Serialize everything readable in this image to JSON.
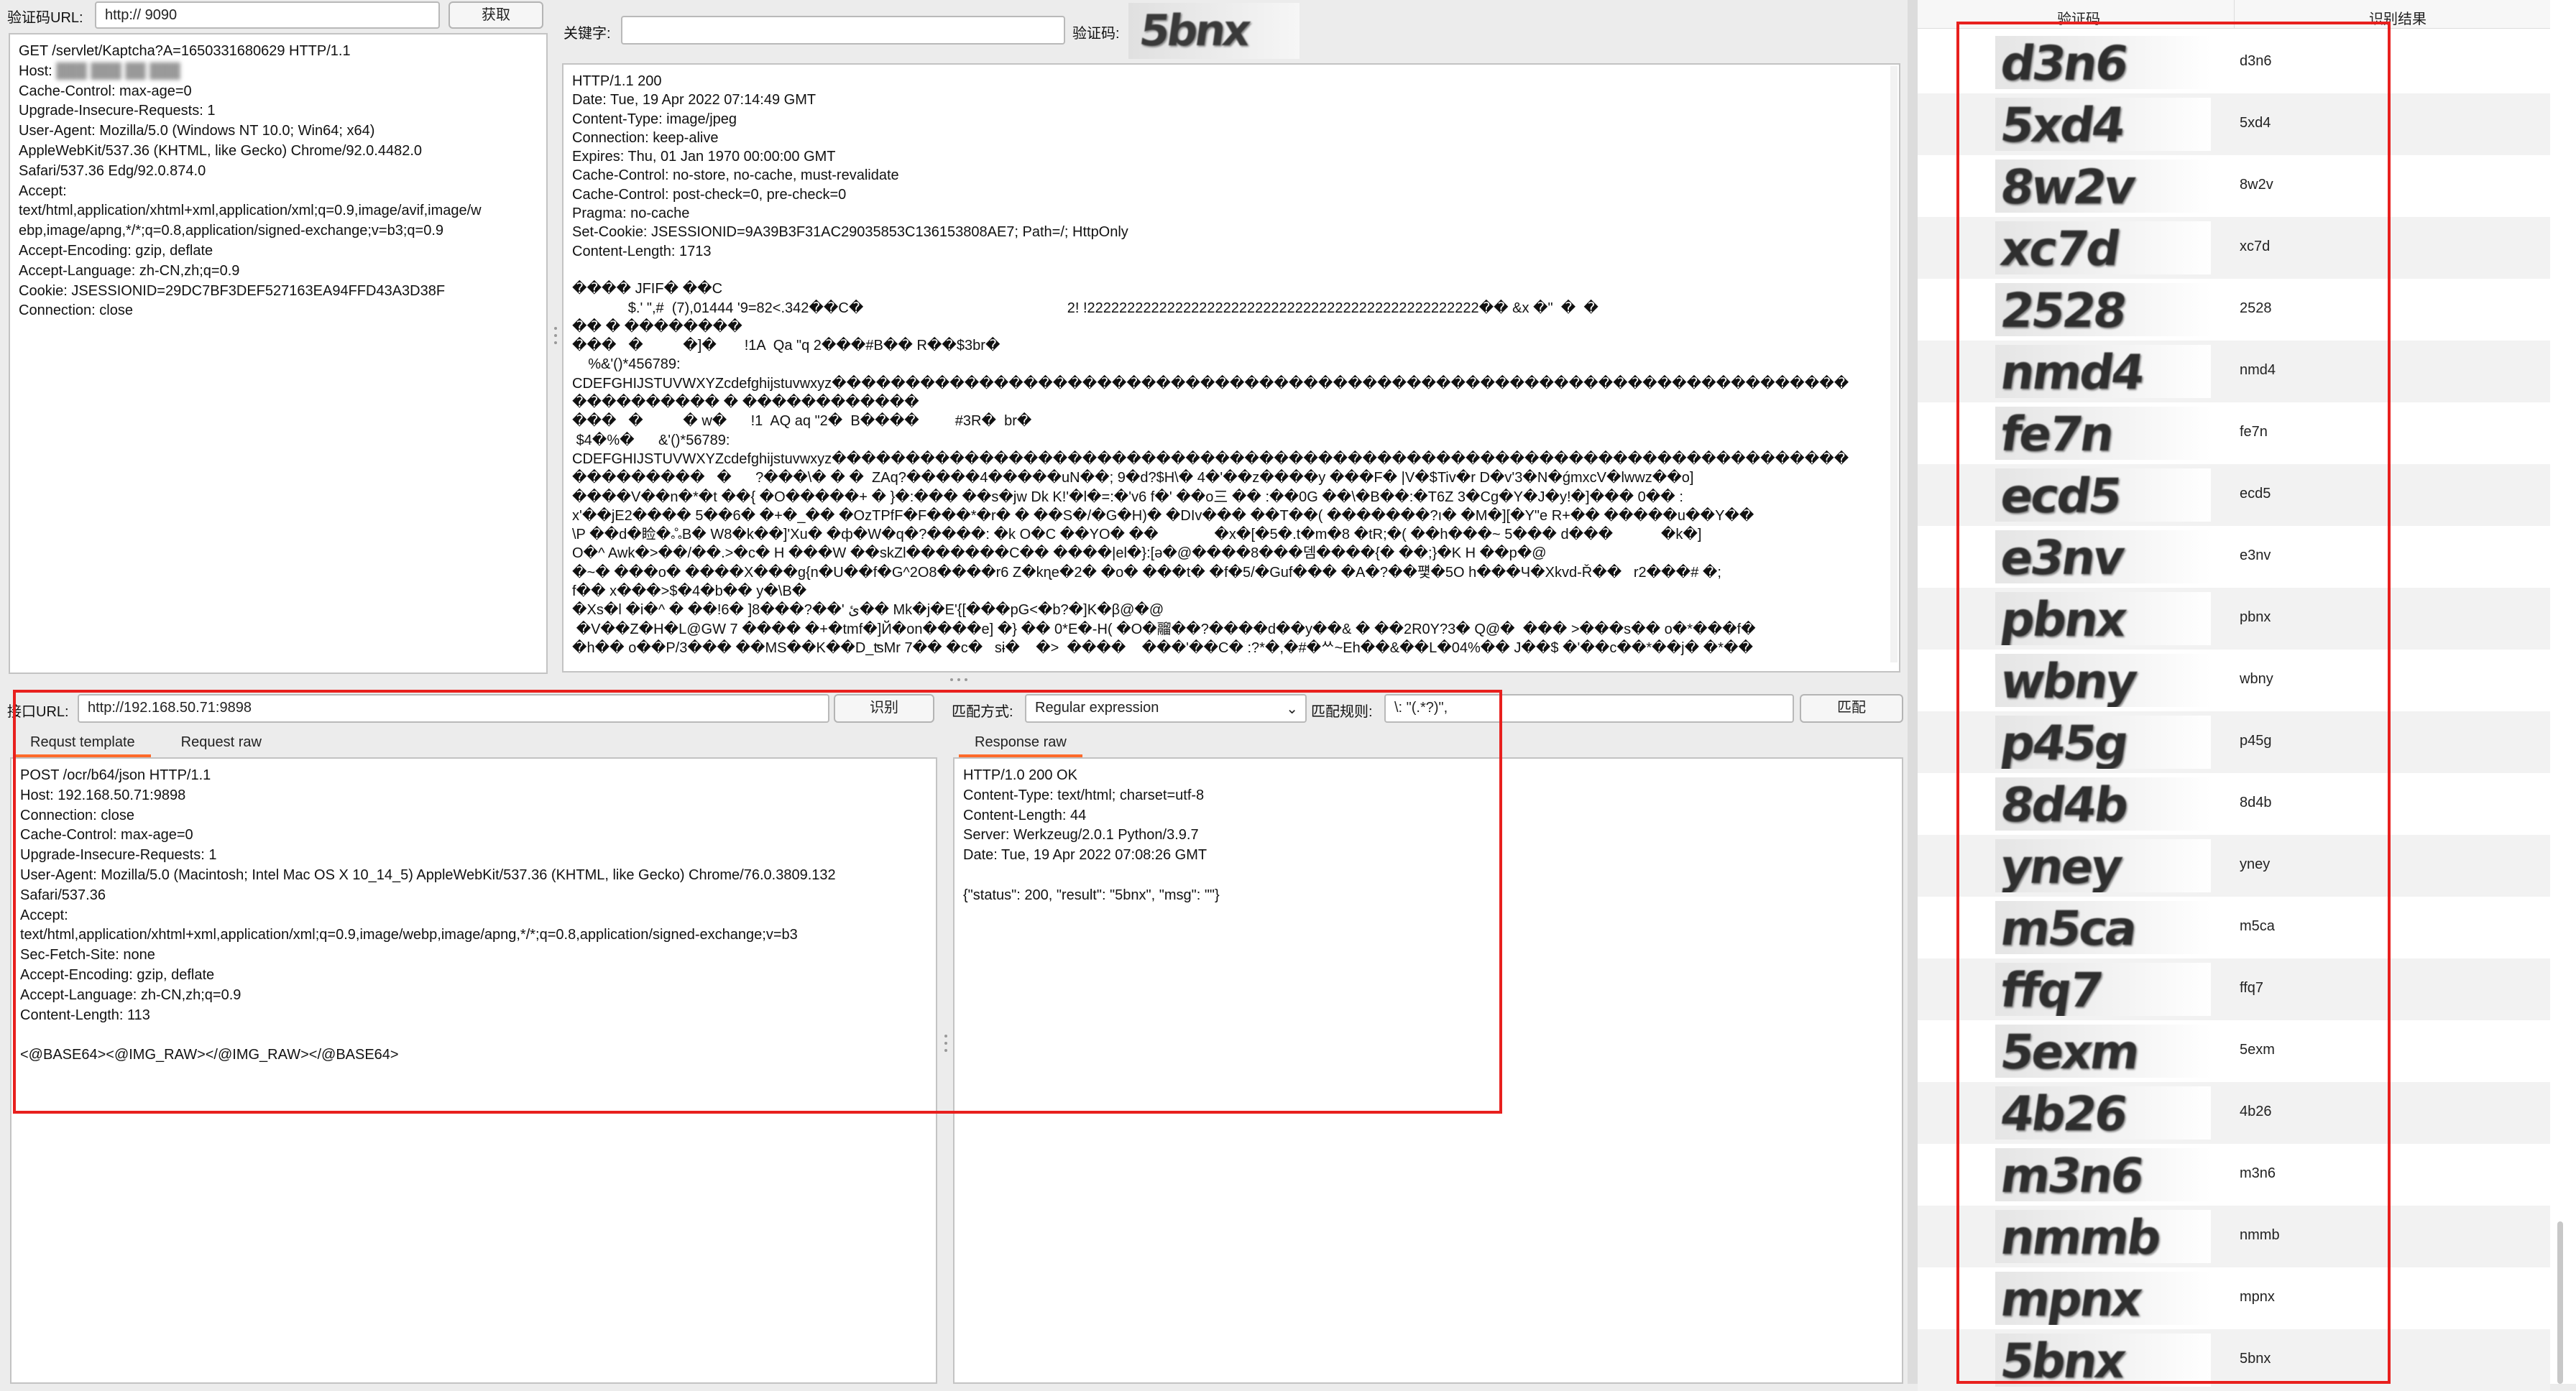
{
  "top_left": {
    "url_label": "验证码URL:",
    "url_value": "http://          9090",
    "fetch_button": "获取",
    "request_lines": [
      "GET /servlet/Kaptcha?A=1650331680629 HTTP/1.1",
      "Host: ",
      "Cache-Control: max-age=0",
      "Upgrade-Insecure-Requests: 1",
      "User-Agent: Mozilla/5.0 (Windows NT 10.0; Win64; x64)",
      "AppleWebKit/537.36 (KHTML, like Gecko) Chrome/92.0.4482.0",
      "Safari/537.36 Edg/92.0.874.0",
      "Accept:",
      "text/html,application/xhtml+xml,application/xml;q=0.9,image/avif,image/w",
      "ebp,image/apng,*/*;q=0.8,application/signed-exchange;v=b3;q=0.9",
      "Accept-Encoding: gzip, deflate",
      "Accept-Language: zh-CN,zh;q=0.9",
      "Cookie: JSESSIONID=29DC7BF3DEF527163EA94FFD43A3D38F",
      "Connection: close"
    ]
  },
  "top_middle": {
    "keyword_label": "关键字:",
    "keyword_value": "",
    "captcha_label": "验证码:",
    "captcha_text": "5bnx",
    "response_headers": [
      "HTTP/1.1 200",
      "Date: Tue, 19 Apr 2022 07:14:49 GMT",
      "Content-Type: image/jpeg",
      "Connection: keep-alive",
      "Expires: Thu, 01 Jan 1970 00:00:00 GMT",
      "Cache-Control: no-store, no-cache, must-revalidate",
      "Cache-Control: post-check=0, pre-check=0",
      "Pragma: no-cache",
      "Set-Cookie: JSESSIONID=9A39B3F31AC29035853C136153808AE7; Path=/; HttpOnly",
      "Content-Length: 1713"
    ],
    "binary_lines": [
      "���� JFIF� ��C",
      "              $.' \",#  (7),01444 '9=82<.342��C�                                                   2! !2222222222222222222222222222222222222222222222222�� &x �\"  �  �",
      "�� � ��������",
      "���   �          �]�       !1A  Qa \"q 2���#B�� R��$3br�",
      "    %&'()*456789:",
      "CDEFGHIJSTUVWXYZcdefghijstuvwxyz���������������������������������������������������������������������",
      "���������� � ������������",
      "���   �          � w�      !1  AQ aq \"2�  B����         #3R�  br�",
      " $4�%�      &'()*56789:",
      "CDEFGHIJSTUVWXYZcdefghijstuvwxyz���������������������������������������������������������������������",
      "���������   �      ?���\\� � �  ZAq?�����4�����uN��; 9�d?$H\\� 4�'��z����y ���F� |V�$Tiv�r D�v'3�N�ǵmxcV�lwwz��o]",
      "����V��n�*�t ��{ �O�����+ � }�:��� ��s�jw Dk K!'�l�=:�'v6 f�' ��o三 �� :��0G ��\\�B��:�T6Z 3�Cg�Y�J�y!�]��� 0�� :",
      "x'��jE2���� 5��6� �+�_�� �OzTPfF�F���*�r� � ��S�/�G�H)� �DIv��� ��T��( �������?ı� �M�][�Y\"e R+�� �����u��Y��",
      "\\P ��d�睑�ஃB� W8�k��]'Xu� �ф�W�q�?����: �k O�C ��YO� ��              �x�[�5�.t�m�8 �tR;�( ��h���~ 5��� d���            �k�]",
      "O�^ Awk�>��/��.>�c� H ���W ��skZl�������C�� ����|el�}:[ə�@����8���뎀����{� ��;}�K H ��p�@",
      "�~� ���o� ����X���g{n�U��f�G^2O8����r6 Z�kɳe�2� �o� ���t� �f�5/�Guf��� �A�?��퍷�5O h���Ч�Xkvd-Ř��   r2���# �;",
      "f�� x���>$�4�b�� y�\\B�",
      "�Xs�l �i�^ � ��!6� ]8���?��' ئ�� Mk�j�E'{[���pG<�b?�]K�β@�@",
      " �V��Z�H�L@GW 7 ���� �+�tmf�]Й�on����e] �} �� 0*E�-H( �O�鬸��?����d��y��& � ��2R0Y?3� Q@�  ��� >���s�� o�*���f�",
      "�h�� o��P/3��� ��MS��K��D_ʦMr 7�� �c�   sɨ�    �>  ����    ���'��C� :?*�,�#�ᄊ~Eh��&��L�04%�� J��$ �'��c��*��j� �*��"
    ]
  },
  "bottom": {
    "api_label": "接口URL:",
    "api_value": "http://192.168.50.71:9898",
    "recognize_button": "识别",
    "match_mode_label": "匹配方式:",
    "match_mode_value": "Regular expression",
    "match_rule_label": "匹配规则:",
    "match_rule_value": "\\: \"(.*?)\",",
    "match_button": "匹配",
    "tabs": [
      "Requst template",
      "Request raw"
    ],
    "request_template_lines": [
      "POST /ocr/b64/json HTTP/1.1",
      "Host: 192.168.50.71:9898",
      "Connection: close",
      "Cache-Control: max-age=0",
      "Upgrade-Insecure-Requests: 1",
      "User-Agent: Mozilla/5.0 (Macintosh; Intel Mac OS X 10_14_5) AppleWebKit/537.36 (KHTML, like Gecko) Chrome/76.0.3809.132",
      "Safari/537.36",
      "Accept:",
      "text/html,application/xhtml+xml,application/xml;q=0.9,image/webp,image/apng,*/*;q=0.8,application/signed-exchange;v=b3",
      "Sec-Fetch-Site: none",
      "Accept-Encoding: gzip, deflate",
      "Accept-Language: zh-CN,zh;q=0.9",
      "Content-Length: 113",
      "",
      "<@BASE64><@IMG_RAW></@IMG_RAW></@BASE64>"
    ],
    "response_tab": "Response raw",
    "response_lines": [
      "HTTP/1.0 200 OK",
      "Content-Type: text/html; charset=utf-8",
      "Content-Length: 44",
      "Server: Werkzeug/2.0.1 Python/3.9.7",
      "Date: Tue, 19 Apr 2022 07:08:26 GMT",
      "",
      "{\"status\": 200, \"result\": \"5bnx\", \"msg\": \"\"}"
    ]
  },
  "results_table": {
    "col_image": "验证码",
    "col_result": "识别结果",
    "rows": [
      {
        "image_text": "d3n6",
        "result": "d3n6"
      },
      {
        "image_text": "5xd4",
        "result": "5xd4"
      },
      {
        "image_text": "8w2v",
        "result": "8w2v"
      },
      {
        "image_text": "xc7d",
        "result": "xc7d"
      },
      {
        "image_text": "2528",
        "result": "2528"
      },
      {
        "image_text": "nmd4",
        "result": "nmd4"
      },
      {
        "image_text": "fe7n",
        "result": "fe7n"
      },
      {
        "image_text": "ecd5",
        "result": "ecd5"
      },
      {
        "image_text": "e3nv",
        "result": "e3nv"
      },
      {
        "image_text": "pbnx",
        "result": "pbnx"
      },
      {
        "image_text": "wbny",
        "result": "wbny"
      },
      {
        "image_text": "p45g",
        "result": "p45g"
      },
      {
        "image_text": "8d4b",
        "result": "8d4b"
      },
      {
        "image_text": "yney",
        "result": "yney"
      },
      {
        "image_text": "m5ca",
        "result": "m5ca"
      },
      {
        "image_text": "ffq7",
        "result": "ffq7"
      },
      {
        "image_text": "5exm",
        "result": "5exm"
      },
      {
        "image_text": "4b26",
        "result": "4b26"
      },
      {
        "image_text": "m3n6",
        "result": "m3n6"
      },
      {
        "image_text": "nmmb",
        "result": "nmmb"
      },
      {
        "image_text": "mpnx",
        "result": "mpnx"
      },
      {
        "image_text": "5bnx",
        "result": "5bnx"
      }
    ]
  }
}
